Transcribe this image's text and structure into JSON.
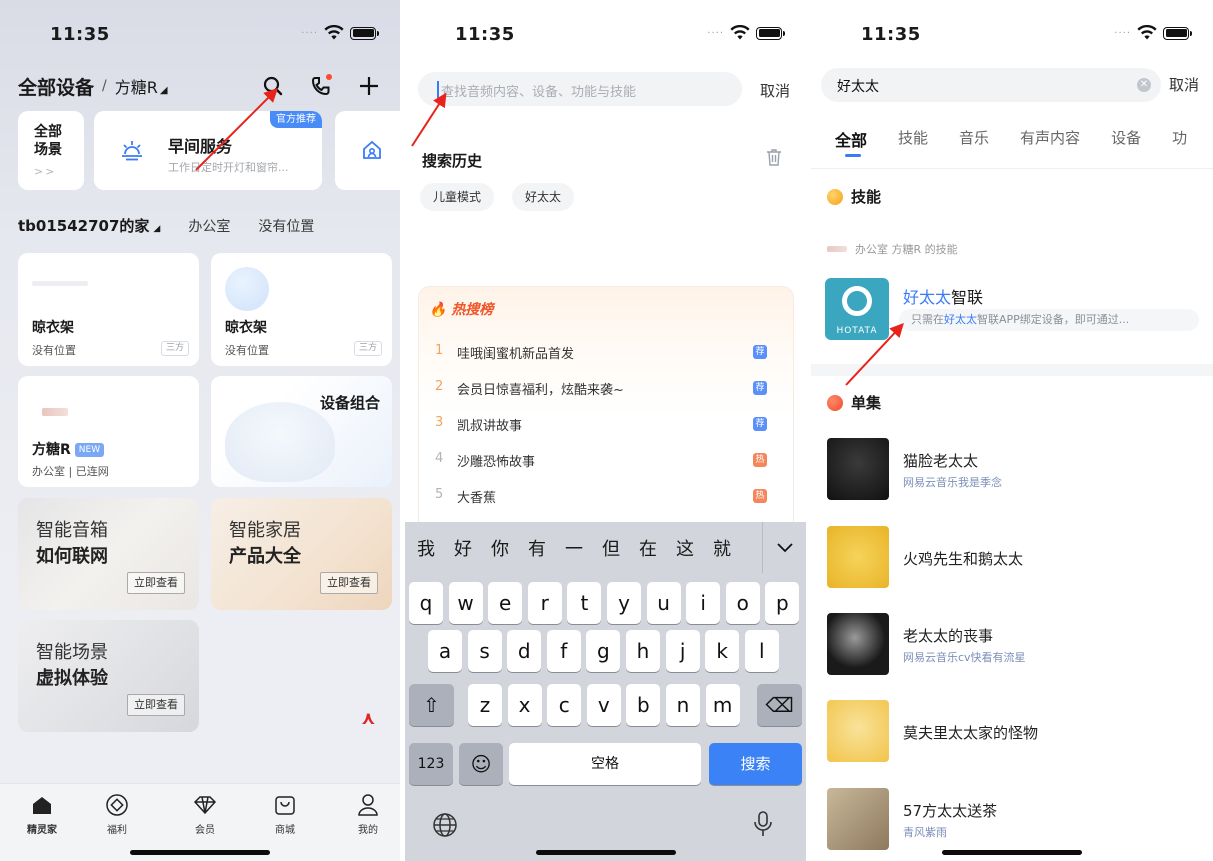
{
  "status": {
    "time": "11:35"
  },
  "home": {
    "title": "全部设备",
    "device_selector": "方糖R",
    "scene_all": {
      "line1": "全部",
      "line2": "场景",
      "more": ">>"
    },
    "scene_card": {
      "badge": "官方推荐",
      "title": "早间服务",
      "subtitle": "工作日定时开灯和窗帘..."
    },
    "home_name": "tb01542707的家",
    "location_tabs": [
      "办公室",
      "没有位置"
    ],
    "devices": [
      {
        "name": "晾衣架",
        "location": "没有位置",
        "tag": "三方"
      },
      {
        "name": "晾衣架",
        "location": "没有位置",
        "tag": "三方"
      },
      {
        "name": "方糖R",
        "badge": "NEW",
        "location": "办公室 | 已连网"
      }
    ],
    "group_card": {
      "title": "设备组合"
    },
    "promos": [
      {
        "line1": "智能音箱",
        "line2": "如何联网",
        "button": "立即查看"
      },
      {
        "line1": "智能家居",
        "line2": "产品大全",
        "button": "立即查看"
      },
      {
        "line1": "智能场景",
        "line2": "虚拟体验",
        "button": "立即查看"
      }
    ],
    "fab": "⋏",
    "tabbar": [
      "精灵家",
      "福利",
      "会员",
      "商城",
      "我的"
    ]
  },
  "search": {
    "placeholder": "查找音频内容、设备、功能与技能",
    "cancel": "取消",
    "history_title": "搜索历史",
    "history": [
      "儿童模式",
      "好太太"
    ],
    "hot_title": "热搜榜",
    "hot": [
      {
        "rank": "1",
        "text": "哇哦闺蜜机新品首发",
        "badge": "荐",
        "color": "#5b8ff9"
      },
      {
        "rank": "2",
        "text": "会员日惊喜福利，炫酷来袭~",
        "badge": "荐",
        "color": "#5b8ff9"
      },
      {
        "rank": "3",
        "text": "凯叔讲故事",
        "badge": "荐",
        "color": "#5b8ff9"
      },
      {
        "rank": "4",
        "text": "沙雕恐怖故事",
        "badge": "热",
        "color": "#f4865b"
      },
      {
        "rank": "5",
        "text": "大香蕉",
        "badge": "热",
        "color": "#f4865b"
      }
    ],
    "keyboard": {
      "suggestions": [
        "我",
        "好",
        "你",
        "有",
        "一",
        "但",
        "在",
        "这",
        "就"
      ],
      "row1": [
        "q",
        "w",
        "e",
        "r",
        "t",
        "y",
        "u",
        "i",
        "o",
        "p"
      ],
      "row2": [
        "a",
        "s",
        "d",
        "f",
        "g",
        "h",
        "j",
        "k",
        "l"
      ],
      "row3": [
        "z",
        "x",
        "c",
        "v",
        "b",
        "n",
        "m"
      ],
      "shift": "⇧",
      "delete": "⌫",
      "numbers": "123",
      "emoji": "☺",
      "space": "空格",
      "search": "搜索"
    }
  },
  "results": {
    "query": "好太太",
    "cancel": "取消",
    "tabs": [
      "全部",
      "技能",
      "音乐",
      "有声内容",
      "设备",
      "功"
    ],
    "skills_title": "技能",
    "skill_source": "办公室 方糖R 的技能",
    "skill": {
      "name_highlight": "好太太",
      "name_rest": "智联",
      "desc_pre": "只需在",
      "desc_highlight": "好太太",
      "desc_rest": "智联APP绑定设备，即可通过...",
      "brand": "HOTATA"
    },
    "episodes_title": "单集",
    "episodes": [
      {
        "title": "猫脸老太太",
        "subtitle": "网易云音乐我是季念"
      },
      {
        "title": "火鸡先生和鹅太太",
        "subtitle": ""
      },
      {
        "title": "老太太的丧事",
        "subtitle": "网易云音乐cv快看有流星"
      },
      {
        "title": "莫夫里太太家的怪物",
        "subtitle": ""
      },
      {
        "title": "57方太太送茶",
        "subtitle": "青风紫雨"
      }
    ]
  },
  "colors": {
    "accent": "#3b7cf6",
    "annotation": "#e8231c",
    "hot": "#f0562a"
  }
}
